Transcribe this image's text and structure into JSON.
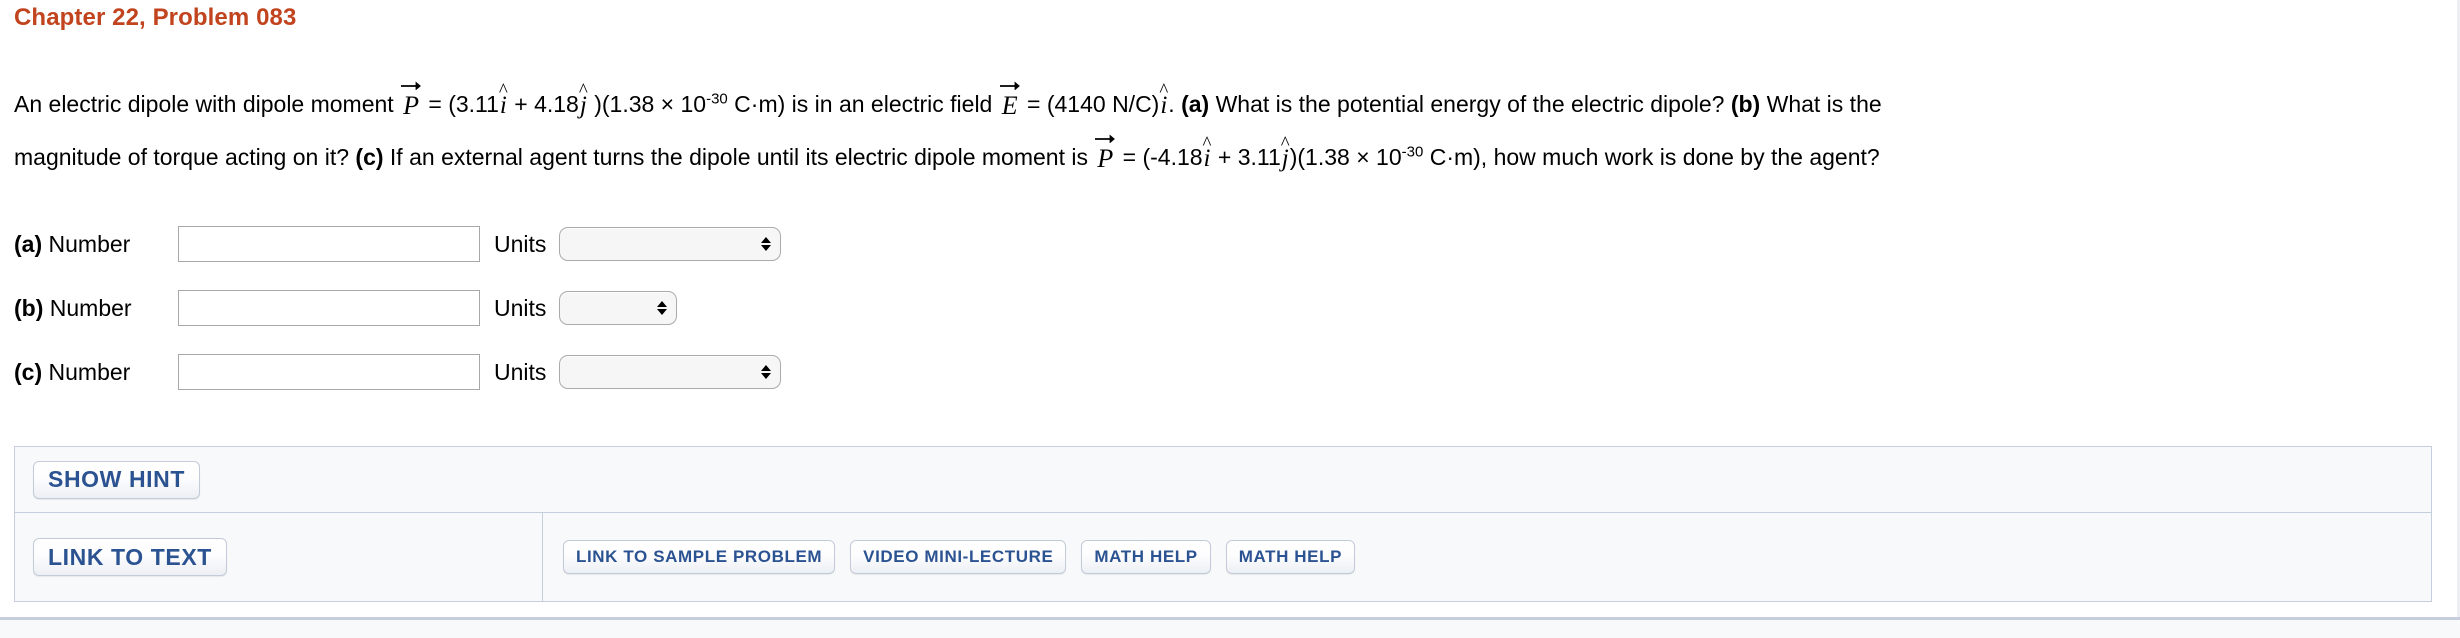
{
  "header": {
    "title": "Chapter 22, Problem 083",
    "title_color": "#c1441e"
  },
  "problem": {
    "line1": {
      "seg1": "An electric dipole with dipole moment ",
      "vec_p": "P",
      "seg2": " = (3.11",
      "hat_i1": "i",
      "seg3": " + 4.18",
      "hat_j1": "j",
      "seg4": " )(1.38 × 10",
      "exp1": "-30",
      "seg5": " C·m) is in an electric field ",
      "vec_e": "E",
      "seg6": " = (4140 N/C)",
      "hat_i2": "i",
      "seg7": ". ",
      "part_a": "(a)",
      "seg8": " What is the potential energy of the electric dipole? ",
      "part_b": "(b)",
      "seg9": " What is the"
    },
    "line2": {
      "seg1": "magnitude of torque acting on it? ",
      "part_c": "(c)",
      "seg2": " If an external agent turns the dipole until its electric dipole moment is ",
      "vec_p": "P",
      "seg3": " = (-4.18",
      "hat_i1": "i",
      "seg4": " + 3.11",
      "hat_j1": "j",
      "seg5": ")(1.38 × 10",
      "exp1": "-30",
      "seg6": " C·m), how much work is done by the agent?"
    }
  },
  "answers": {
    "number_label": "Number",
    "units_label": "Units",
    "rows": [
      {
        "part": "(a)",
        "number_value": "",
        "units_value": "",
        "select_size": "wide"
      },
      {
        "part": "(b)",
        "number_value": "",
        "units_value": "",
        "select_size": "narrow"
      },
      {
        "part": "(c)",
        "number_value": "",
        "units_value": "",
        "select_size": "wide"
      }
    ]
  },
  "help": {
    "show_hint": "SHOW HINT",
    "link_to_text": "LINK TO TEXT",
    "resources": [
      "LINK TO SAMPLE PROBLEM",
      "VIDEO MINI-LECTURE",
      "MATH HELP",
      "MATH HELP"
    ],
    "button_text_color": "#2b5291",
    "panel_border_color": "#c6cedd"
  }
}
